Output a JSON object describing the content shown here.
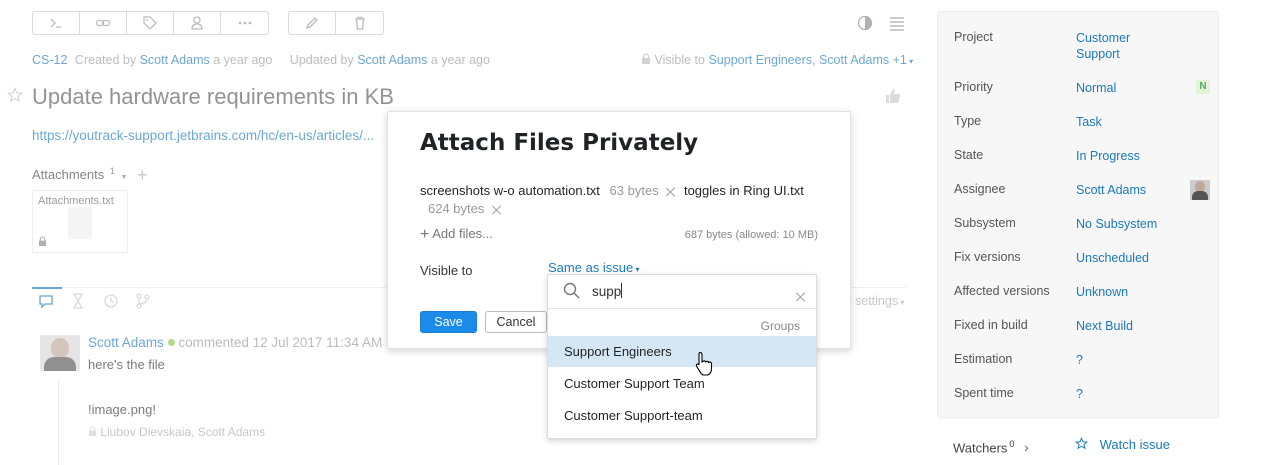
{
  "issue": {
    "id": "CS-12",
    "created_prefix": "Created by",
    "created_by": "Scott Adams",
    "created_ago": "a year ago",
    "updated_prefix": "Updated by",
    "updated_by": "Scott Adams",
    "updated_ago": "a year ago",
    "visible_prefix": "Visible to",
    "visible_to": "Support Engineers, Scott Adams +1",
    "title": "Update hardware requirements in KB",
    "description_link": "https://youtrack-support.jetbrains.com/hc/en-us/articles/..."
  },
  "attachments": {
    "label": "Attachments",
    "count": "1",
    "file_name": "Attachments.txt"
  },
  "activity": {
    "settings_label": "settings",
    "comment_author": "Scott Adams",
    "comment_action": "commented 12 Jul 2017 11:34 AM",
    "comment_text": "here's the file",
    "comment_image": "!image.png!",
    "comment_visibility": "Liubov Dievskaia, Scott Adams"
  },
  "modal": {
    "title": "Attach Files Privately",
    "file1_name": "screenshots w-o automation.txt",
    "file1_size": "63 bytes",
    "file2_name": "toggles in Ring UI.txt",
    "file2_size": "624 bytes",
    "add_files_label": "Add files...",
    "total_size": "687 bytes (allowed: 10 MB)",
    "visible_to_label": "Visible to",
    "visible_to_value": "Same as issue",
    "save_label": "Save",
    "cancel_label": "Cancel"
  },
  "dropdown": {
    "search_value": "supp",
    "section_label": "Groups",
    "items": [
      "Support Engineers",
      "Customer Support Team",
      "Customer Support-team"
    ]
  },
  "sidebar": {
    "fields": [
      {
        "name": "Project",
        "value": "Customer Support"
      },
      {
        "name": "Priority",
        "value": "Normal",
        "badge": "N"
      },
      {
        "name": "Type",
        "value": "Task"
      },
      {
        "name": "State",
        "value": "In Progress"
      },
      {
        "name": "Assignee",
        "value": "Scott Adams"
      },
      {
        "name": "Subsystem",
        "value": "No Subsystem"
      },
      {
        "name": "Fix versions",
        "value": "Unscheduled"
      },
      {
        "name": "Affected versions",
        "value": "Unknown"
      },
      {
        "name": "Fixed in build",
        "value": "Next Build"
      },
      {
        "name": "Estimation",
        "value": "?"
      },
      {
        "name": "Spent time",
        "value": "?"
      }
    ],
    "watchers_label": "Watchers",
    "watchers_count": "0",
    "watch_issue_label": "Watch issue"
  },
  "colors": {
    "link": "#1c79bd",
    "primary_button": "#1a8be8",
    "highlight": "#d5e6f5",
    "online": "#8bc34a",
    "priority_badge": "#59a869"
  },
  "icons": [
    "command-icon",
    "link-icon",
    "tag-icon",
    "user-icon",
    "more-icon",
    "edit-icon",
    "delete-icon",
    "contrast-icon",
    "list-icon",
    "star-icon",
    "thumbs-up-icon",
    "lock-icon",
    "plus-icon",
    "search-icon",
    "clear-icon",
    "pointer-cursor-icon"
  ]
}
